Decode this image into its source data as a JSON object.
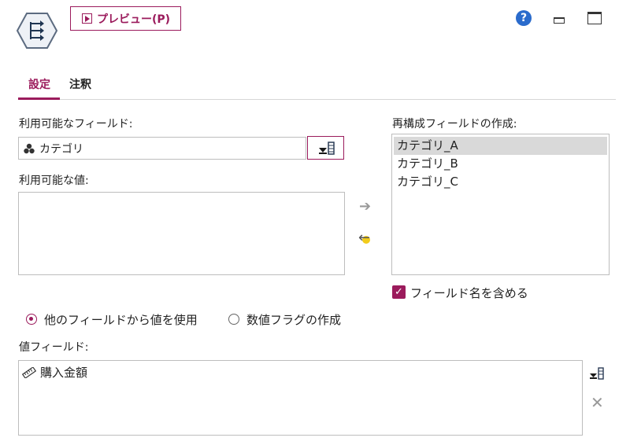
{
  "toolbar": {
    "preview_label": "プレビュー(P)",
    "help_icon": "help-icon",
    "help_glyph": "?"
  },
  "tabs": [
    {
      "label": "設定",
      "active": true
    },
    {
      "label": "注釈",
      "active": false
    }
  ],
  "available_fields": {
    "label": "利用可能なフィールド:",
    "selected_value": "カテゴリ",
    "icon": "nominal-field-icon"
  },
  "available_values": {
    "label": "利用可能な値:",
    "items": []
  },
  "restructured_fields": {
    "label": "再構成フィールドの作成:",
    "items": [
      "カテゴリ_A",
      "カテゴリ_B",
      "カテゴリ_C"
    ],
    "selected_index": 0
  },
  "include_field_name": {
    "label": "フィールド名を含める",
    "checked": true
  },
  "mode": {
    "options": [
      "他のフィールドから値を使用",
      "数値フラグの作成"
    ],
    "selected_index": 0
  },
  "value_fields": {
    "label": "値フィールド:",
    "items": [
      {
        "label": "購入金額",
        "icon": "continuous-field-icon"
      }
    ]
  },
  "colors": {
    "accent": "#9b1b5c",
    "selection": "#d9d9d9",
    "help_blue": "#2a6bcc"
  }
}
